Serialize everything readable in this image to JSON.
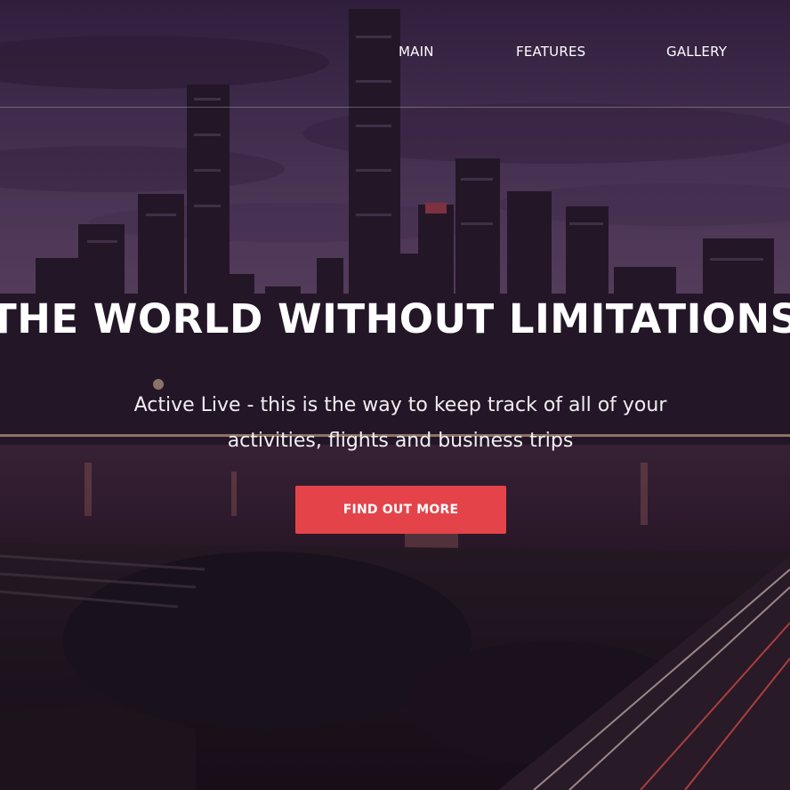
{
  "nav": {
    "items": [
      {
        "label": "MAIN"
      },
      {
        "label": "FEATURES"
      },
      {
        "label": "GALLERY"
      }
    ]
  },
  "hero": {
    "headline": "THE WORLD WITHOUT LIMITATIONS",
    "subtitle_line1": "Active Live - this is the way to keep track of all of your",
    "subtitle_line2": "activities, flights and business trips",
    "cta_label": "FIND OUT MORE"
  },
  "colors": {
    "accent": "#e4434a",
    "sky_top": "#3a2747",
    "sky_mid": "#5a3f66",
    "water": "#2b1a28"
  }
}
